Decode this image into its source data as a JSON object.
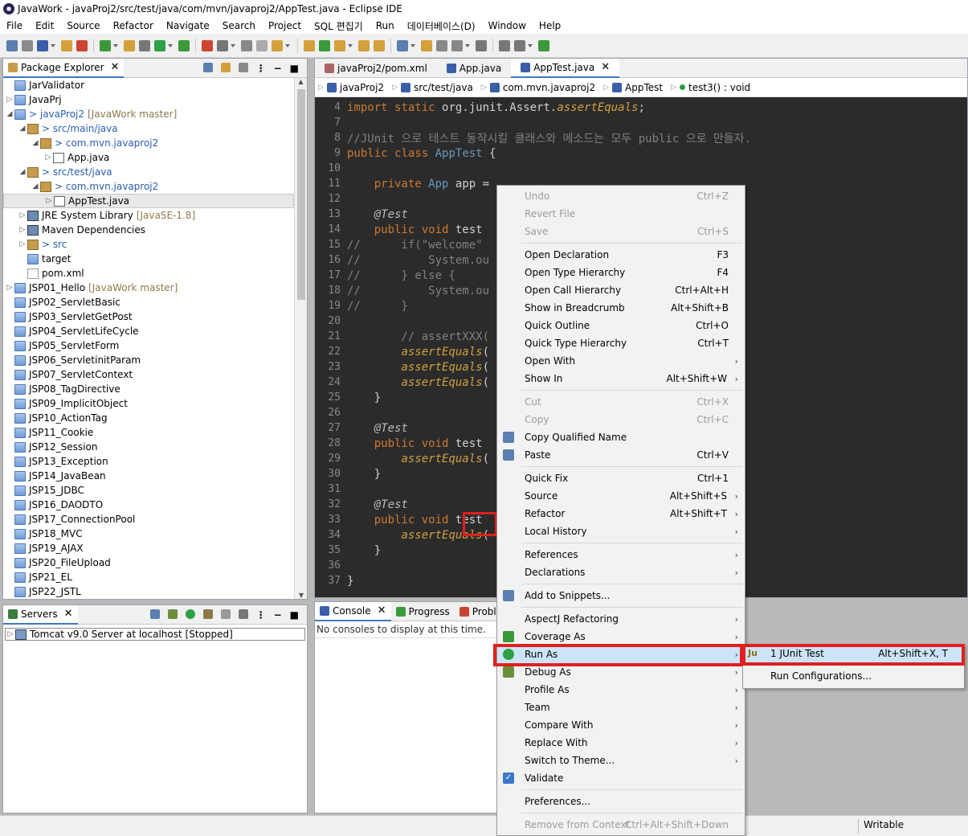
{
  "window": {
    "title": "JavaWork - javaProj2/src/test/java/com/mvn/javaproj2/AppTest.java - Eclipse IDE"
  },
  "menubar": [
    "File",
    "Edit",
    "Source",
    "Refactor",
    "Navigate",
    "Search",
    "Project",
    "SQL 편집기",
    "Run",
    "데이터베이스(D)",
    "Window",
    "Help"
  ],
  "package_explorer": {
    "tab_label": "Package Explorer",
    "items": [
      {
        "label": "JarValidator",
        "decoration": ""
      },
      {
        "label": "JavaPrj",
        "decoration": ""
      },
      {
        "label": "> javaProj2",
        "decoration": "[JavaWork master]"
      },
      {
        "label": "> src/main/java",
        "decoration": ""
      },
      {
        "label": "> com.mvn.javaproj2",
        "decoration": ""
      },
      {
        "label": "App.java",
        "decoration": ""
      },
      {
        "label": "> src/test/java",
        "decoration": ""
      },
      {
        "label": "> com.mvn.javaproj2",
        "decoration": ""
      },
      {
        "label": "AppTest.java",
        "decoration": ""
      },
      {
        "label": "JRE System Library",
        "decoration": "[JavaSE-1.8]"
      },
      {
        "label": "Maven Dependencies",
        "decoration": ""
      },
      {
        "label": "> src",
        "decoration": ""
      },
      {
        "label": "target",
        "decoration": ""
      },
      {
        "label": "pom.xml",
        "decoration": ""
      },
      {
        "label": "JSP01_Hello",
        "decoration": "[JavaWork master]"
      },
      {
        "label": "JSP02_ServletBasic",
        "decoration": ""
      },
      {
        "label": "JSP03_ServletGetPost",
        "decoration": ""
      },
      {
        "label": "JSP04_ServletLifeCycle",
        "decoration": ""
      },
      {
        "label": "JSP05_ServletForm",
        "decoration": ""
      },
      {
        "label": "JSP06_ServletinitParam",
        "decoration": ""
      },
      {
        "label": "JSP07_ServletContext",
        "decoration": ""
      },
      {
        "label": "JSP08_TagDirective",
        "decoration": ""
      },
      {
        "label": "JSP09_ImplicitObject",
        "decoration": ""
      },
      {
        "label": "JSP10_ActionTag",
        "decoration": ""
      },
      {
        "label": "JSP11_Cookie",
        "decoration": ""
      },
      {
        "label": "JSP12_Session",
        "decoration": ""
      },
      {
        "label": "JSP13_Exception",
        "decoration": ""
      },
      {
        "label": "JSP14_JavaBean",
        "decoration": ""
      },
      {
        "label": "JSP15_JDBC",
        "decoration": ""
      },
      {
        "label": "JSP16_DAODTO",
        "decoration": ""
      },
      {
        "label": "JSP17_ConnectionPool",
        "decoration": ""
      },
      {
        "label": "JSP18_MVC",
        "decoration": ""
      },
      {
        "label": "JSP19_AJAX",
        "decoration": ""
      },
      {
        "label": "JSP20_FileUpload",
        "decoration": ""
      },
      {
        "label": "JSP21_EL",
        "decoration": ""
      },
      {
        "label": "JSP22_JSTL",
        "decoration": ""
      }
    ]
  },
  "servers": {
    "tab_label": "Servers",
    "item": "Tomcat v9.0 Server at localhost  [Stopped]"
  },
  "editor": {
    "tabs": [
      "javaProj2/pom.xml",
      "App.java",
      "AppTest.java"
    ],
    "breadcrumb": [
      "javaProj2",
      "src/test/java",
      "com.mvn.javaproj2",
      "AppTest",
      "test3() : void"
    ],
    "lines": [
      {
        "n": "4",
        "t": "import static org.junit.Assert.assertEquals;"
      },
      {
        "n": "7",
        "t": ""
      },
      {
        "n": "8",
        "t": "//JUnit 으로 테스트 동작시킬 클래스와 메소드는 모두 public 으로 만들자."
      },
      {
        "n": "9",
        "t": "public class AppTest {"
      },
      {
        "n": "10",
        "t": ""
      },
      {
        "n": "11",
        "t": "    private App app ="
      },
      {
        "n": "12",
        "t": ""
      },
      {
        "n": "13",
        "t": "    @Test"
      },
      {
        "n": "14",
        "t": "    public void test"
      },
      {
        "n": "15",
        "t": "//      if(\"welcome\""
      },
      {
        "n": "16",
        "t": "//          System.ou"
      },
      {
        "n": "17",
        "t": "//      } else {"
      },
      {
        "n": "18",
        "t": "//          System.ou"
      },
      {
        "n": "19",
        "t": "//      }"
      },
      {
        "n": "20",
        "t": ""
      },
      {
        "n": "21",
        "t": "        // assertXXX("
      },
      {
        "n": "22",
        "t": "        assertEquals("
      },
      {
        "n": "23",
        "t": "        assertEquals("
      },
      {
        "n": "24",
        "t": "        assertEquals("
      },
      {
        "n": "25",
        "t": "    }"
      },
      {
        "n": "26",
        "t": ""
      },
      {
        "n": "27",
        "t": "    @Test"
      },
      {
        "n": "28",
        "t": "    public void test"
      },
      {
        "n": "29",
        "t": "        assertEquals("
      },
      {
        "n": "30",
        "t": "    }"
      },
      {
        "n": "31",
        "t": ""
      },
      {
        "n": "32",
        "t": "    @Test"
      },
      {
        "n": "33",
        "t": "    public void test"
      },
      {
        "n": "34",
        "t": "        assertEquals("
      },
      {
        "n": "35",
        "t": "    }"
      },
      {
        "n": "36",
        "t": ""
      },
      {
        "n": "37",
        "t": "}"
      }
    ]
  },
  "console": {
    "tabs": [
      "Console",
      "Progress",
      "Proble"
    ],
    "message": "No consoles to display at this time."
  },
  "context_menu": [
    {
      "label": "Undo",
      "shortcut": "Ctrl+Z",
      "disabled": true
    },
    {
      "label": "Revert File",
      "shortcut": "",
      "disabled": true
    },
    {
      "label": "Save",
      "shortcut": "Ctrl+S",
      "disabled": true
    },
    {
      "sep": true
    },
    {
      "label": "Open Declaration",
      "shortcut": "F3"
    },
    {
      "label": "Open Type Hierarchy",
      "shortcut": "F4"
    },
    {
      "label": "Open Call Hierarchy",
      "shortcut": "Ctrl+Alt+H"
    },
    {
      "label": "Show in Breadcrumb",
      "shortcut": "Alt+Shift+B"
    },
    {
      "label": "Quick Outline",
      "shortcut": "Ctrl+O"
    },
    {
      "label": "Quick Type Hierarchy",
      "shortcut": "Ctrl+T"
    },
    {
      "label": "Open With",
      "shortcut": "",
      "sub": true
    },
    {
      "label": "Show In",
      "shortcut": "Alt+Shift+W",
      "sub": true
    },
    {
      "sep": true
    },
    {
      "label": "Cut",
      "shortcut": "Ctrl+X",
      "disabled": true
    },
    {
      "label": "Copy",
      "shortcut": "Ctrl+C",
      "disabled": true
    },
    {
      "label": "Copy Qualified Name",
      "shortcut": ""
    },
    {
      "label": "Paste",
      "shortcut": "Ctrl+V"
    },
    {
      "sep": true
    },
    {
      "label": "Quick Fix",
      "shortcut": "Ctrl+1"
    },
    {
      "label": "Source",
      "shortcut": "Alt+Shift+S",
      "sub": true
    },
    {
      "label": "Refactor",
      "shortcut": "Alt+Shift+T",
      "sub": true
    },
    {
      "label": "Local History",
      "shortcut": "",
      "sub": true
    },
    {
      "sep": true
    },
    {
      "label": "References",
      "shortcut": "",
      "sub": true
    },
    {
      "label": "Declarations",
      "shortcut": "",
      "sub": true
    },
    {
      "sep": true
    },
    {
      "label": "Add to Snippets...",
      "shortcut": ""
    },
    {
      "sep": true
    },
    {
      "label": "AspectJ Refactoring",
      "shortcut": "",
      "sub": true
    },
    {
      "label": "Coverage As",
      "shortcut": "",
      "sub": true
    },
    {
      "label": "Run As",
      "shortcut": "",
      "sub": true,
      "highlight": true
    },
    {
      "label": "Debug As",
      "shortcut": "",
      "sub": true
    },
    {
      "label": "Profile As",
      "shortcut": "",
      "sub": true
    },
    {
      "label": "Team",
      "shortcut": "",
      "sub": true
    },
    {
      "label": "Compare With",
      "shortcut": "",
      "sub": true
    },
    {
      "label": "Replace With",
      "shortcut": "",
      "sub": true
    },
    {
      "label": "Switch to Theme...",
      "shortcut": "",
      "sub": true
    },
    {
      "label": "Validate",
      "shortcut": "",
      "check": true
    },
    {
      "sep": true
    },
    {
      "label": "Preferences...",
      "shortcut": ""
    },
    {
      "sep": true
    },
    {
      "label": "Remove from Context",
      "shortcut": "Ctrl+Alt+Shift+Down",
      "disabled": true
    }
  ],
  "run_as_submenu": [
    {
      "label": "1 JUnit Test",
      "shortcut": "Alt+Shift+X, T"
    },
    {
      "label": "Run Configurations...",
      "shortcut": ""
    }
  ],
  "status": {
    "writable": "Writable"
  },
  "colors": {
    "highlight": "#e02020",
    "editor_bg": "#2b2b2b",
    "menu_hover": "#cce4f7"
  }
}
